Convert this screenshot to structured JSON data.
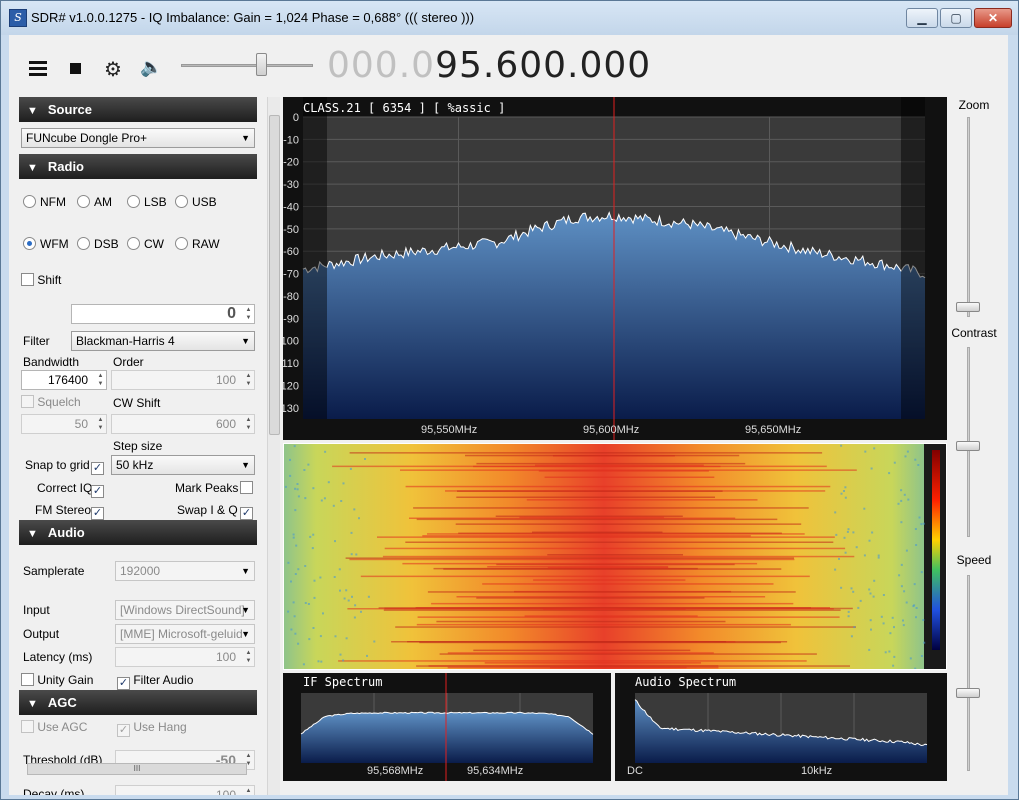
{
  "window": {
    "title": "SDR# v1.0.0.1275 - IQ Imbalance: Gain = 1,024 Phase = 0,688° ((( stereo )))",
    "minimize": "▁",
    "maximize": "▢",
    "close": "✕"
  },
  "toolbar": {
    "frequency_dim": "000.0",
    "frequency_bright": "95.600.000",
    "volume_percent": 60
  },
  "source": {
    "header": "Source",
    "device": "FUNcube Dongle Pro+"
  },
  "radio": {
    "header": "Radio",
    "modes_row1": [
      "NFM",
      "AM",
      "LSB",
      "USB"
    ],
    "modes_row2": [
      "WFM",
      "DSB",
      "CW",
      "RAW"
    ],
    "selected_mode": "WFM",
    "shift_label": "Shift",
    "shift_value": "0",
    "filter_label": "Filter",
    "filter_value": "Blackman-Harris 4",
    "bandwidth_label": "Bandwidth",
    "bandwidth_value": "176400",
    "order_label": "Order",
    "order_value": "100",
    "squelch_label": "Squelch",
    "squelch_value": "50",
    "cwshift_label": "CW Shift",
    "cwshift_value": "600",
    "stepsize_label": "Step size",
    "snap_label": "Snap to grid",
    "stepsize_value": "50 kHz",
    "correct_iq_label": "Correct IQ",
    "mark_peaks_label": "Mark Peaks",
    "fm_stereo_label": "FM Stereo",
    "swap_iq_label": "Swap I & Q"
  },
  "audio": {
    "header": "Audio",
    "samplerate_label": "Samplerate",
    "samplerate_value": "192000",
    "input_label": "Input",
    "input_value": "[Windows DirectSound]",
    "output_label": "Output",
    "output_value": "[MME] Microsoft-geluid",
    "latency_label": "Latency (ms)",
    "latency_value": "100",
    "unity_gain_label": "Unity Gain",
    "filter_audio_label": "Filter Audio"
  },
  "agc": {
    "header": "AGC",
    "use_agc_label": "Use AGC",
    "use_hang_label": "Use Hang",
    "threshold_label": "Threshold (dB)",
    "threshold_value": "-50",
    "decay_label": "Decay (ms)",
    "decay_value": "100"
  },
  "scroll": {
    "grip": "III"
  },
  "main_spectrum": {
    "overlay_text": "CLASS.21 [ 6354 ]  [ %assic ]",
    "freq_labels": [
      "95,550MHz",
      "95,600MHz",
      "95,650MHz"
    ]
  },
  "if_spectrum": {
    "title": "IF Spectrum",
    "freq_labels": [
      "95,568MHz",
      "95,634MHz"
    ]
  },
  "audio_spectrum": {
    "title": "Audio Spectrum",
    "freq_labels": [
      "DC",
      "10kHz"
    ]
  },
  "right_panel": {
    "zoom_label": "Zoom",
    "contrast_label": "Contrast",
    "speed_label": "Speed"
  },
  "chart_data": [
    {
      "type": "area",
      "x": [
        95.52,
        95.53,
        95.54,
        95.55,
        95.56,
        95.57,
        95.58,
        95.59,
        95.6,
        95.61,
        95.62,
        95.63,
        95.64,
        95.65,
        95.66,
        95.67,
        95.68
      ],
      "series": [
        {
          "values": [
            -68,
            -65,
            -62,
            -60,
            -58,
            -56,
            -50,
            -45,
            -44,
            -46,
            -48,
            -52,
            -56,
            -60,
            -63,
            -66,
            -70
          ]
        }
      ],
      "xlabel": "",
      "ylabel": "",
      "xticks": [
        "95,550MHz",
        "95,600MHz",
        "95,650MHz"
      ],
      "yticks": [
        "0",
        "-10",
        "-20",
        "-30",
        "-40",
        "-50",
        "-60",
        "-70",
        "-80",
        "-90",
        "-100",
        "-110",
        "-120",
        "-130"
      ],
      "ylim": [
        -135,
        0
      ],
      "grid": true
    },
    {
      "type": "area",
      "series": [
        {
          "values": [
            -80,
            -50,
            -45,
            -44,
            -44,
            -44,
            -44,
            -44,
            -44,
            -44,
            -45,
            -50,
            -80
          ]
        }
      ],
      "xticks": [
        "95,568MHz",
        "95,634MHz"
      ],
      "ylim": [
        -130,
        -10
      ],
      "grid": true
    },
    {
      "type": "area",
      "series": [
        {
          "values": [
            -20,
            -60,
            -62,
            -64,
            -66,
            -68,
            -70,
            -72,
            -74,
            -76,
            -78,
            -80,
            -85
          ]
        }
      ],
      "xticks": [
        "DC",
        "10kHz"
      ],
      "ylim": [
        -110,
        -10
      ],
      "grid": true
    }
  ]
}
